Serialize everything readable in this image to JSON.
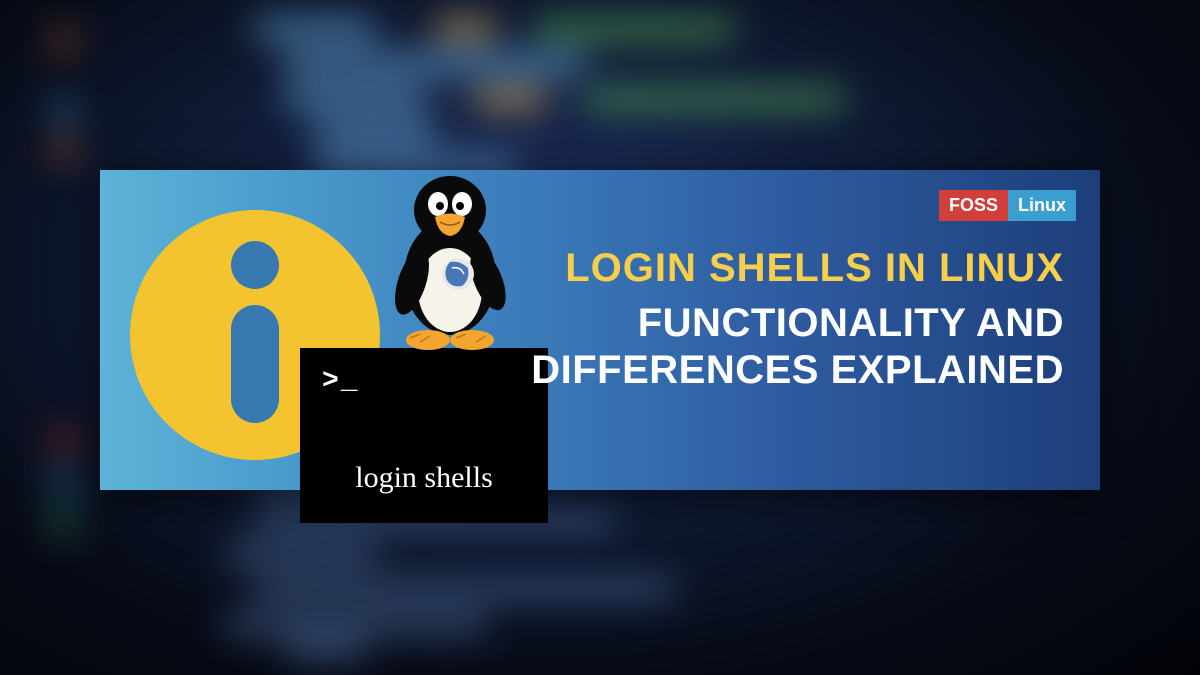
{
  "logo": {
    "left": "FOSS",
    "right": "Linux"
  },
  "headline": "LOGIN SHELLS IN LINUX",
  "subhead_line1": "FUNCTIONALITY AND",
  "subhead_line2": "DIFFERENCES EXPLAINED",
  "terminal": {
    "prompt": ">_",
    "caption": "login shells"
  },
  "colors": {
    "accent_yellow": "#f7cf4a",
    "info_yellow": "#f4c430",
    "info_blue": "#3878b0",
    "logo_red": "#d13f3a",
    "logo_blue": "#3a9ed1"
  }
}
